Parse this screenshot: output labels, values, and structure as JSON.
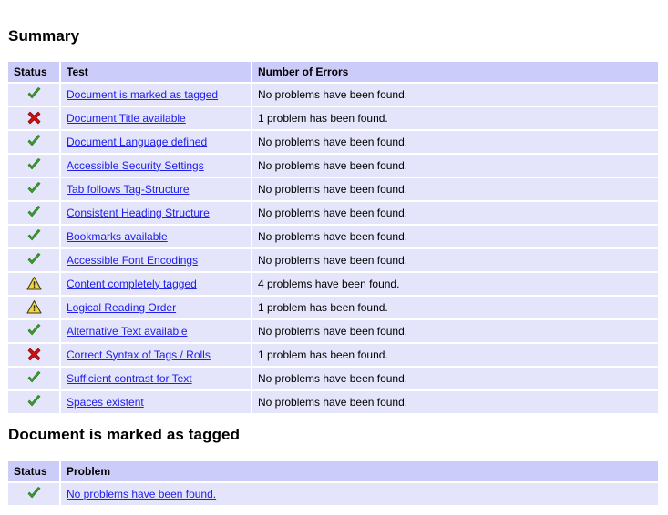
{
  "summary": {
    "heading": "Summary",
    "columns": {
      "status": "Status",
      "test": "Test",
      "errors": "Number of Errors"
    },
    "rows": [
      {
        "status": "pass",
        "test": "Document is marked as tagged",
        "errors": "No problems have been found."
      },
      {
        "status": "fail",
        "test": "Document Title available",
        "errors": "1 problem has been found."
      },
      {
        "status": "pass",
        "test": "Document Language defined",
        "errors": "No problems have been found."
      },
      {
        "status": "pass",
        "test": "Accessible Security Settings",
        "errors": "No problems have been found."
      },
      {
        "status": "pass",
        "test": "Tab follows Tag-Structure",
        "errors": "No problems have been found."
      },
      {
        "status": "pass",
        "test": "Consistent Heading Structure",
        "errors": "No problems have been found."
      },
      {
        "status": "pass",
        "test": "Bookmarks available",
        "errors": "No problems have been found."
      },
      {
        "status": "pass",
        "test": "Accessible Font Encodings",
        "errors": "No problems have been found."
      },
      {
        "status": "warning",
        "test": "Content completely tagged",
        "errors": "4 problems have been found."
      },
      {
        "status": "warning",
        "test": "Logical Reading Order",
        "errors": "1 problem has been found."
      },
      {
        "status": "pass",
        "test": "Alternative Text available",
        "errors": "No problems have been found."
      },
      {
        "status": "fail",
        "test": "Correct Syntax of Tags / Rolls",
        "errors": "1 problem has been found."
      },
      {
        "status": "pass",
        "test": "Sufficient contrast for Text",
        "errors": "No problems have been found."
      },
      {
        "status": "pass",
        "test": "Spaces existent",
        "errors": "No problems have been found."
      }
    ]
  },
  "detail": {
    "heading": "Document is marked as tagged",
    "columns": {
      "status": "Status",
      "problem": "Problem"
    },
    "rows": [
      {
        "status": "pass",
        "problem": "No problems have been found."
      }
    ]
  },
  "icons": {
    "pass": "check-icon",
    "fail": "cross-icon",
    "warning": "warning-icon"
  },
  "colors": {
    "header_bg": "#ccccfa",
    "row_bg": "#e4e4fa",
    "page_bg": "#ffffff",
    "link": "#2020ee",
    "pass_green": "#3a9e2f",
    "fail_red": "#cc1111",
    "warning_yellow": "#f5d442",
    "text": "#000000"
  }
}
